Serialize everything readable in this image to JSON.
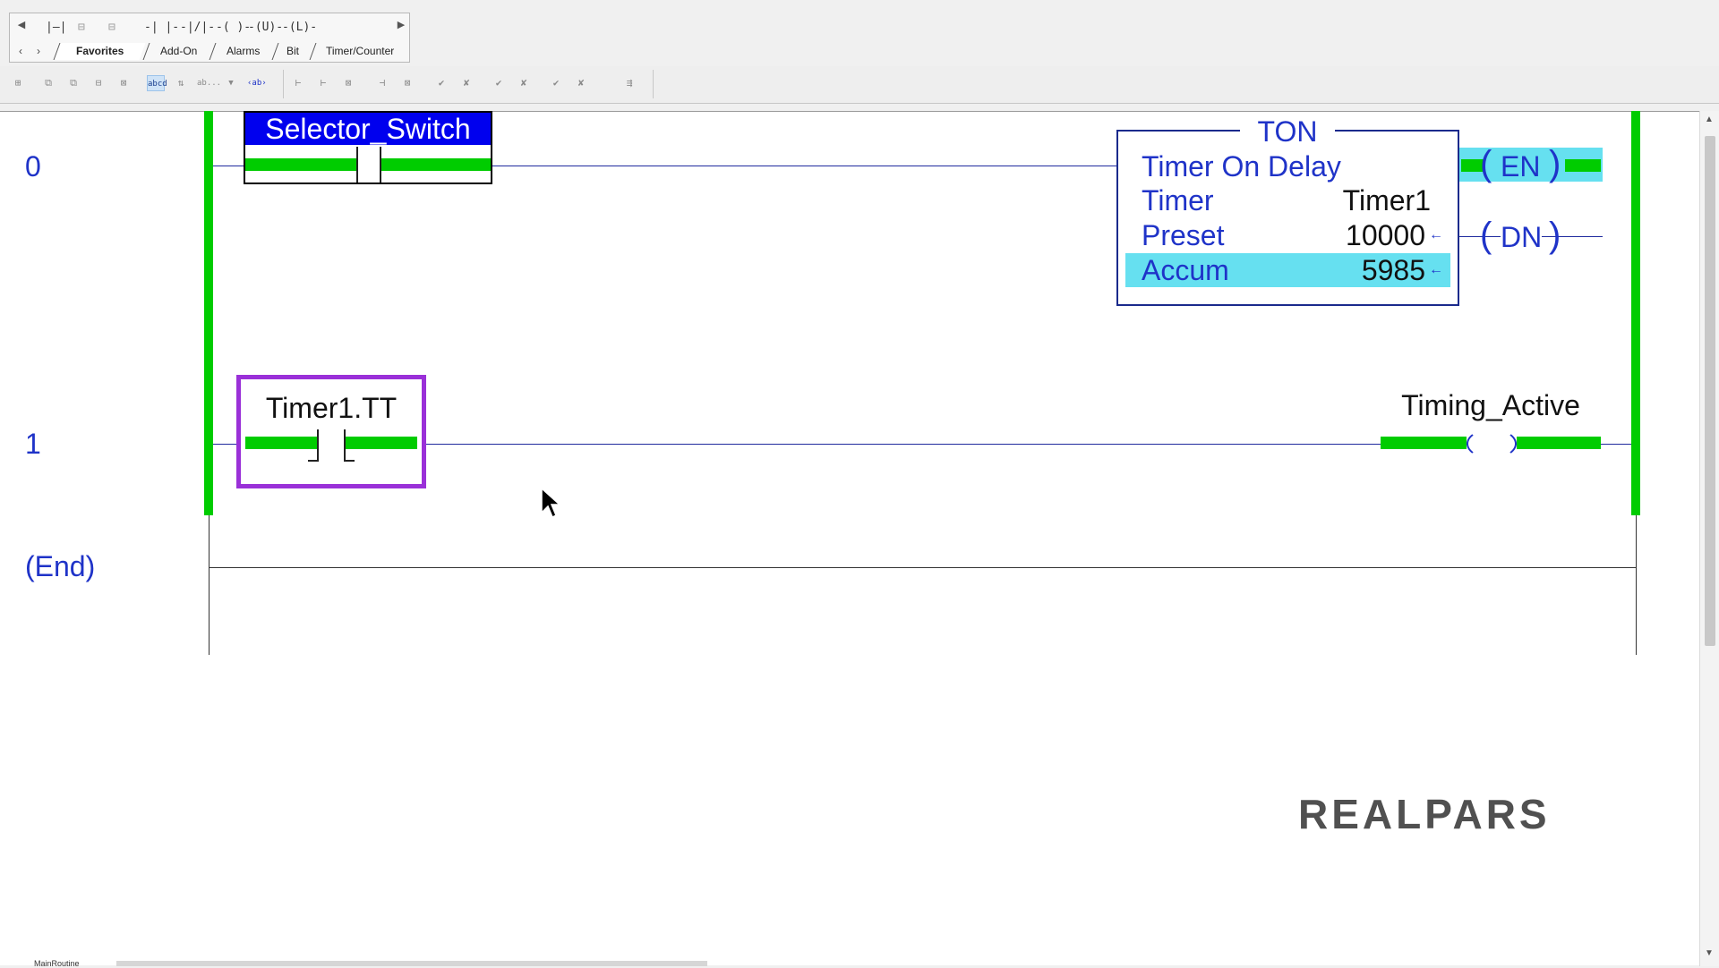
{
  "palette": {
    "instructions": [
      "|—|",
      "⊟",
      "⊟",
      "-| |-",
      "-|/|-",
      "-( )-",
      "-(U)-",
      "-(L)-"
    ],
    "tabs": [
      "Favorites",
      "Add-On",
      "Alarms",
      "Bit",
      "Timer/Counter"
    ],
    "active_tab": "Favorites"
  },
  "toolbar": {
    "tag_label_btn": "abcd",
    "ab_btn": "ab...",
    "ab_btn2": "‹ab›"
  },
  "rungs": [
    {
      "number": "0"
    },
    {
      "number": "1"
    }
  ],
  "end_label": "(End)",
  "rung0": {
    "contact_tag": "Selector_Switch",
    "timer": {
      "type": "TON",
      "description": "Timer On Delay",
      "rows": [
        {
          "label": "Timer",
          "value": "Timer1"
        },
        {
          "label": "Preset",
          "value": "10000"
        },
        {
          "label": "Accum",
          "value": "5985"
        }
      ]
    },
    "outputs": [
      "EN",
      "DN"
    ]
  },
  "rung1": {
    "contact_tag": "Timer1.TT",
    "coil_tag": "Timing_Active"
  },
  "logo": "REALPARS",
  "routine_tab": "MainRoutine",
  "colors": {
    "energized": "#00cc00",
    "rung_text": "#1f33c8",
    "selected_tag": "#0000ee",
    "highlight_box": "#9a30d8",
    "accum_highlight": "#66e0f0"
  }
}
